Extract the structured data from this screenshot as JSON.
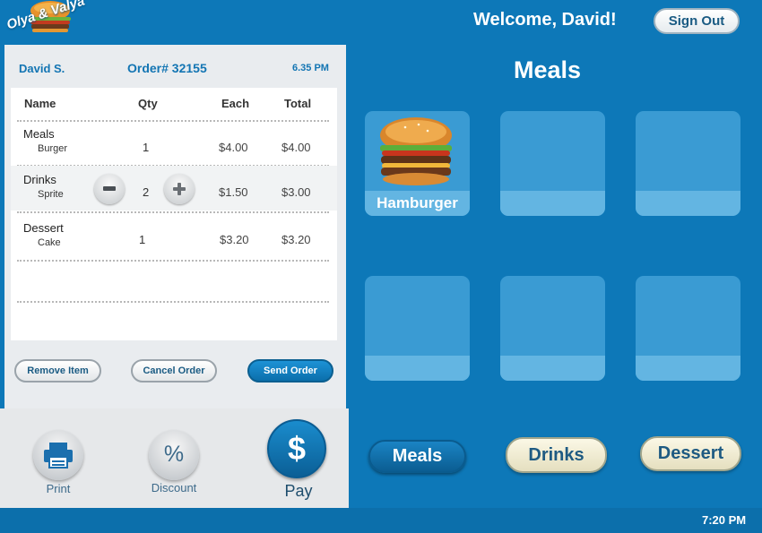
{
  "header": {
    "logo_text": "Olya & Valya",
    "welcome": "Welcome, David!",
    "signout_label": "Sign Out"
  },
  "order": {
    "customer": "David S.",
    "number": "Order# 32155",
    "time": "6.35 PM",
    "columns": [
      "Name",
      "Qty",
      "Each",
      "Total"
    ],
    "rows": [
      {
        "category": "Meals",
        "item": "Burger",
        "qty": "1",
        "each": "$4.00",
        "total": "$4.00"
      },
      {
        "category": "Drinks",
        "item": "Sprite",
        "qty": "2",
        "each": "$1.50",
        "total": "$3.00"
      },
      {
        "category": "Dessert",
        "item": "Cake",
        "qty": "1",
        "each": "$3.20",
        "total": "$3.20"
      }
    ]
  },
  "actions": {
    "remove": "Remove Item",
    "cancel": "Cancel Order",
    "send": "Send Order"
  },
  "bottom": {
    "print": "Print",
    "discount": "Discount",
    "discount_symbol": "%",
    "pay": "Pay",
    "pay_symbol": "$"
  },
  "menu": {
    "title": "Meals",
    "tiles": [
      {
        "label": "Hamburger"
      },
      {
        "label": ""
      },
      {
        "label": ""
      },
      {
        "label": ""
      },
      {
        "label": ""
      },
      {
        "label": ""
      }
    ],
    "categories": [
      "Meals",
      "Drinks",
      "Dessert"
    ],
    "active_category": "Meals"
  },
  "footer": {
    "clock": "7:20 PM"
  },
  "colors": {
    "brand_blue": "#0d78b8",
    "panel": "#e9ecef",
    "tile": "#3a9bd3"
  }
}
